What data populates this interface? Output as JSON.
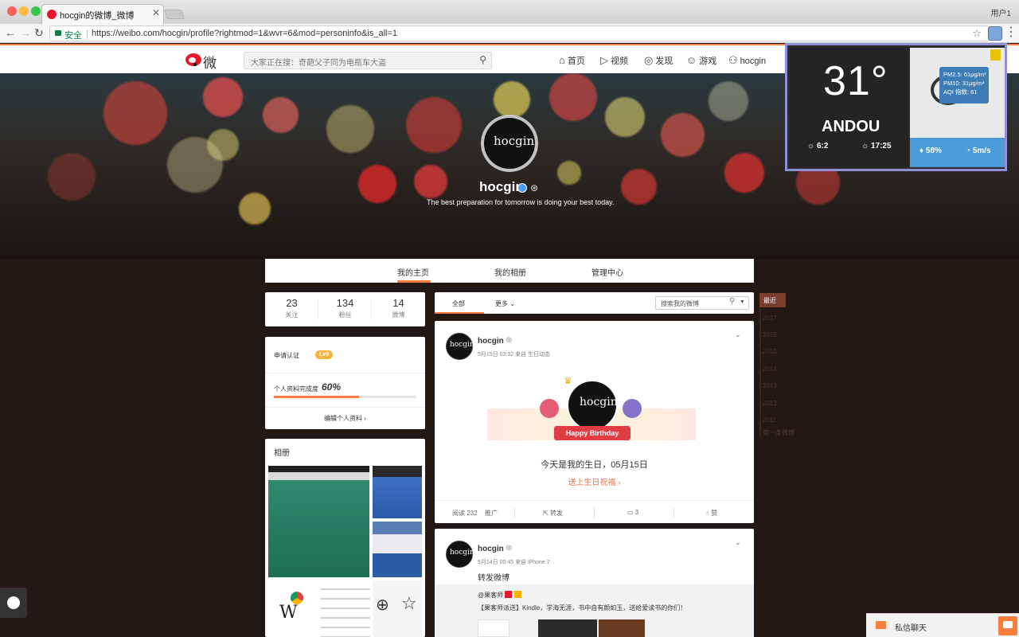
{
  "browser": {
    "tab_title": "hocgin的微博_微博",
    "user_label": "用户1",
    "secure_label": "安全",
    "url": "https://weibo.com/hocgin/profile?rightmod=1&wvr=6&mod=personinfo&is_all=1"
  },
  "header": {
    "logo_text": "微博",
    "search_placeholder": "大家正在搜：奇葩父子同为电瓶车大盗",
    "nav": [
      "首页",
      "视频",
      "发现",
      "游戏",
      "hocgin"
    ]
  },
  "cover": {
    "name": "hocgin",
    "bio": "The best preparation for tomorrow is doing your best today.",
    "avatar_text": "hocgin"
  },
  "profile_tabs": [
    "我的主页",
    "我的相册",
    "管理中心"
  ],
  "stats": [
    {
      "value": "23",
      "label": "关注"
    },
    {
      "value": "134",
      "label": "粉丝"
    },
    {
      "value": "14",
      "label": "微博"
    }
  ],
  "profile_card": {
    "apply_label": "申请认证",
    "level": "Lv9",
    "complete_label": "个人资料完成度",
    "complete_value": "60%",
    "complete_fraction": 0.6,
    "edit_label": "编辑个人资料 ›"
  },
  "album": {
    "title": "相册"
  },
  "feed_tabs": {
    "all": "全部",
    "more": "更多",
    "search_placeholder": "搜索我的微博"
  },
  "post1": {
    "user": "hocgin",
    "meta": "5月15日 03:32 来自 生日动态",
    "banner": "Happy Birthday",
    "text": "今天是我的生日，05月15日",
    "link": "送上生日祝福 ›",
    "read": "阅读 232",
    "promote": "推广",
    "repost": "转发",
    "comments": "3",
    "like": "赞"
  },
  "post2": {
    "user": "hocgin",
    "meta": "5月14日 00:45 来自 iPhone 7",
    "text": "转发微博",
    "quote_author": "@果客师",
    "quote_body": "【果客师派送】Kindle，学海无涯，书中自有颜如玉，送给爱读书的你们！"
  },
  "years": {
    "recent": "最近",
    "list": [
      "2017",
      "2016",
      "2015",
      "2014",
      "2013",
      "2012",
      "2011"
    ],
    "first": "第一条微博"
  },
  "weather": {
    "temp": "31°",
    "city": "ANDOU",
    "sunrise": "6:2",
    "sunset": "17:25",
    "humidity": "58%",
    "wind": "5m/s",
    "pm25": "PM2.5: 61μg/m³",
    "pm10": "PM10: 31μg/m³",
    "aqi": "AQI 指数: 61"
  },
  "chat": {
    "label": "私信聊天"
  },
  "colors": {
    "accent": "#fa7d3c",
    "weibo_red": "#e6162d",
    "weather_blue": "#4b9bd9",
    "weather_border": "#8f90d8"
  }
}
